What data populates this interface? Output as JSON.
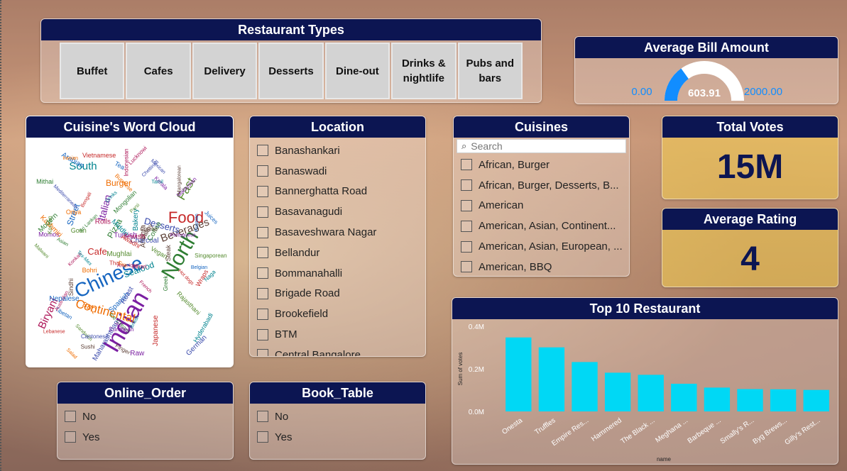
{
  "restaurant_types": {
    "title": "Restaurant Types",
    "items": [
      "Buffet",
      "Cafes",
      "Delivery",
      "Desserts",
      "Dine-out",
      "Drinks & nightlife",
      "Pubs and bars"
    ]
  },
  "avg_bill": {
    "title": "Average Bill Amount",
    "value": "603.91",
    "value_num": 603.91,
    "min": "0.00",
    "max": "2000.00",
    "min_num": 0,
    "max_num": 2000,
    "fill_color": "#118dff",
    "track_color": "#ffffff"
  },
  "word_cloud": {
    "title": "Cuisine's Word Cloud",
    "words": [
      "Indian",
      "Chinese",
      "North",
      "Food",
      "Continental",
      "South",
      "Biryani",
      "Fast",
      "Beverages",
      "Desserts",
      "Italian",
      "Street",
      "Pizza",
      "Cafe",
      "Burger",
      "Seafood",
      "American",
      "Mughlai",
      "Andhra",
      "Mexican",
      "Kerala",
      "Arabian",
      "Asian",
      "Thai",
      "Salad",
      "Bakery",
      "Rolls",
      "Sandwich",
      "Healthy",
      "Mediterranean",
      "Momos",
      "Juices",
      "Ice Cream",
      "Bengali",
      "BBQ",
      "Hyderabadi",
      "Lucknowi",
      "Goan",
      "Sushi",
      "Charcoal",
      "European",
      "Tibetan",
      "Mithai",
      "Japanese",
      "Iranian",
      "British",
      "Indonesian",
      "Korean",
      "Mangalorean",
      "Chettinad",
      "Turkish",
      "Spanish",
      "Greek",
      "Lebanese",
      "Oriya",
      "Middle",
      "Jewish",
      "Vegan",
      "Finger",
      "Roast",
      "Raw",
      "Tea",
      "Coffee",
      "Awadhi",
      "Kashmiri",
      "Tamil",
      "Konkan",
      "Singaporean",
      "Sindhi",
      "Cantonese",
      "Malaysian",
      "Belgian",
      "Mongolian",
      "Vietnamese",
      "Grill",
      "Drinks",
      "Australian",
      "Parsi",
      "Steak",
      "German",
      "Portuguese",
      "Nepalese",
      "Sri Lankan",
      "Wraps",
      "Bohri",
      "Naga",
      "Bihari",
      "Rajasthani",
      "Gujarati",
      "Maharashtrian",
      "Afghan",
      "Russian",
      "Modern",
      "Hot dogs",
      "Burmese",
      "Tex-Mex",
      "French",
      "Malwani"
    ]
  },
  "location": {
    "title": "Location",
    "items": [
      "Banashankari",
      "Banaswadi",
      "Bannerghatta Road",
      "Basavanagudi",
      "Basaveshwara Nagar",
      "Bellandur",
      "Bommanahalli",
      "Brigade Road",
      "Brookefield",
      "BTM",
      "Central Bangalore"
    ]
  },
  "cuisines": {
    "title": "Cuisines",
    "search_placeholder": "Search",
    "items": [
      "African, Burger",
      "African, Burger, Desserts, B...",
      "American",
      "American, Asian, Continent...",
      "American, Asian, European, ...",
      "American, BBQ"
    ]
  },
  "total_votes": {
    "title": "Total Votes",
    "value": "15M"
  },
  "avg_rating": {
    "title": "Average Rating",
    "value": "4"
  },
  "online_order": {
    "title": "Online_Order",
    "items": [
      "No",
      "Yes"
    ]
  },
  "book_table": {
    "title": "Book_Table",
    "items": [
      "No",
      "Yes"
    ]
  },
  "top10": {
    "title": "Top 10 Restaurant",
    "chart_data": {
      "type": "bar",
      "title": "Top 10 Restaurant",
      "xlabel": "name",
      "ylabel": "Sum of votes",
      "categories": [
        "Onesta",
        "Truffles",
        "Empire Res...",
        "Hammered",
        "The Black ...",
        "Meghana ...",
        "Barbeque ...",
        "Smally's R...",
        "Byg Brews...",
        "Gilly's Rest..."
      ],
      "values": [
        347520,
        301000,
        232000,
        182000,
        172000,
        130000,
        112000,
        105000,
        104000,
        101000
      ],
      "yticks": [
        "0.0M",
        "0.2M",
        "0.4M"
      ],
      "ylim": [
        0,
        400000
      ],
      "bar_color": "#00d8f5",
      "grid": false
    }
  }
}
